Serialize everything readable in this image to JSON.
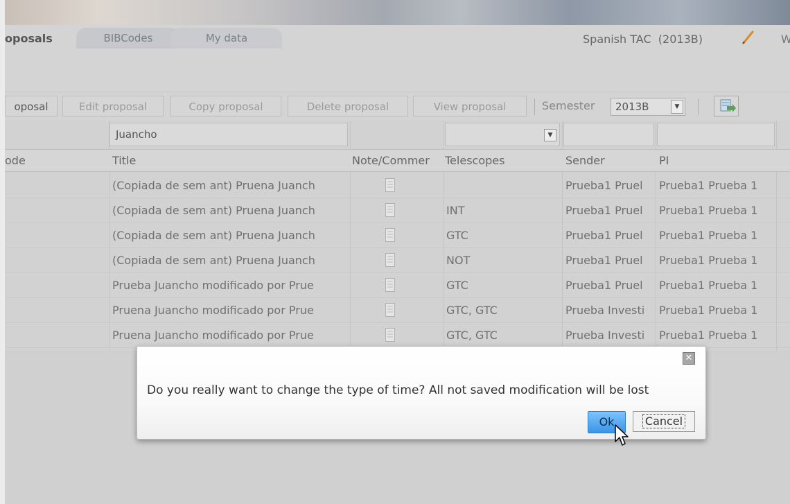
{
  "header": {
    "active_tab": "oposals",
    "tabs": [
      "BIBCodes",
      "My data"
    ],
    "tac_label": "Spanish TAC  (2013B)",
    "right_letter": "W"
  },
  "toolbar": {
    "buttons": [
      "oposal",
      "Edit proposal",
      "Copy proposal",
      "Delete proposal",
      "View proposal"
    ],
    "semester_label": "Semester",
    "semester_value": "2013B"
  },
  "grid": {
    "filters": {
      "title": "Juancho",
      "telescopes": "",
      "sender": "",
      "pi": ""
    },
    "columns": [
      "ode",
      "Title",
      "Note/Commer",
      "Telescopes",
      "Sender",
      "PI"
    ],
    "rows": [
      {
        "title": "(Copiada de sem ant) Pruena Juanch",
        "telescopes": "",
        "sender": "Prueba1 Pruel",
        "pi": "Prueba1 Prueba 1"
      },
      {
        "title": "(Copiada de sem ant) Pruena Juanch",
        "telescopes": "INT",
        "sender": "Prueba1 Pruel",
        "pi": "Prueba1 Prueba 1"
      },
      {
        "title": "(Copiada de sem ant) Pruena Juanch",
        "telescopes": "GTC",
        "sender": "Prueba1 Pruel",
        "pi": "Prueba1 Prueba 1"
      },
      {
        "title": "(Copiada de sem ant) Pruena Juanch",
        "telescopes": "NOT",
        "sender": "Prueba1 Pruel",
        "pi": "Prueba1 Prueba 1"
      },
      {
        "title": "Prueba Juancho modificado por Prue",
        "telescopes": "GTC",
        "sender": "Prueba1 Pruel",
        "pi": "Prueba1 Prueba 1"
      },
      {
        "title": "Pruena Juancho modificado por Prue",
        "telescopes": "GTC, GTC",
        "sender": "Prueba Investi",
        "pi": "Prueba1 Prueba 1"
      },
      {
        "title": "Pruena Juancho modificado por Prue",
        "telescopes": "GTC, GTC",
        "sender": "Prueba Investi",
        "pi": "Prueba1 Prueba 1"
      }
    ]
  },
  "dialog": {
    "message": "Do you really want to change the type of time? All not saved modification will be lost",
    "ok_label": "Ok",
    "cancel_label": "Cancel",
    "close_glyph": "✕"
  },
  "icons": {
    "pencil": "pencil-icon",
    "export": "export-icon",
    "note": "document-icon",
    "cursor": "mouse-pointer-icon"
  }
}
